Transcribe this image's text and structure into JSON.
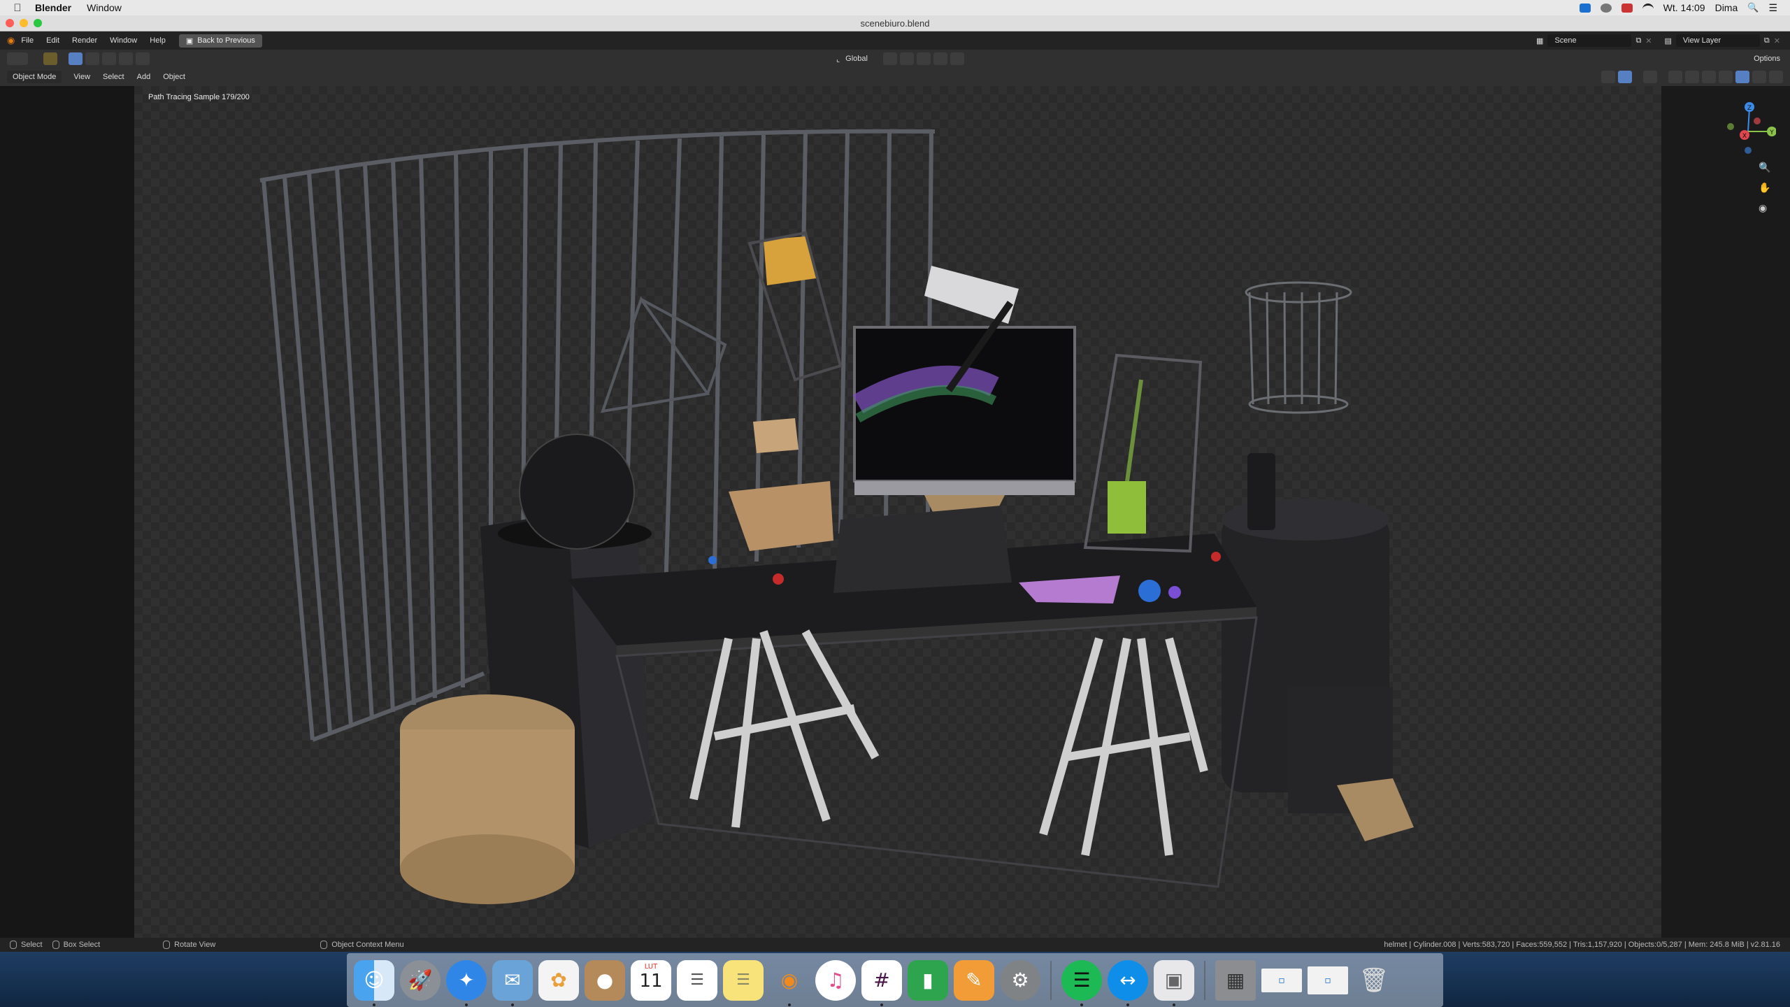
{
  "menubar": {
    "app_name": "Blender",
    "menu_window": "Window",
    "clock": "Wt. 14:09",
    "user": "Dima"
  },
  "window": {
    "title": "scenebiuro.blend"
  },
  "topbar": {
    "menus": [
      "File",
      "Edit",
      "Render",
      "Window",
      "Help"
    ],
    "back_button": "Back to Previous",
    "scene_field": "Scene",
    "view_layer_field": "View Layer"
  },
  "toolbar": {
    "orientation": "Global",
    "options": "Options"
  },
  "header": {
    "mode": "Object Mode",
    "menus": [
      "View",
      "Select",
      "Add",
      "Object"
    ]
  },
  "viewport": {
    "render_status": "Path Tracing Sample 179/200",
    "gizmo_axes": {
      "z": "Z",
      "y": "Y",
      "x": "X"
    }
  },
  "statusbar": {
    "select": "Select",
    "box_select": "Box Select",
    "rotate_view": "Rotate View",
    "context_menu": "Object Context Menu",
    "stats": "helmet | Cylinder.008 | Verts:583,720 | Faces:559,552 | Tris:1,157,920 | Objects:0/5,287 | Mem: 245.8 MiB | v2.81.16"
  },
  "dock": {
    "calendar_month": "LUT",
    "calendar_day": "11"
  },
  "colors": {
    "accent_blue": "#5680c2",
    "axis_x": "#e0464e",
    "axis_y": "#8bc34a",
    "axis_z": "#3c8ce7"
  }
}
